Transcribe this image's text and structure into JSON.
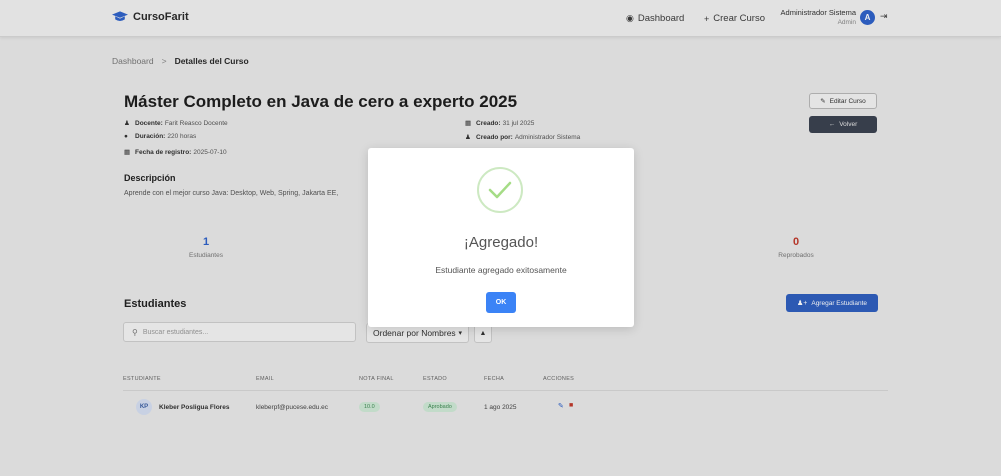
{
  "navbar": {
    "brand": "CursoFarit",
    "dashboard_label": "Dashboard",
    "create_course_label": "Crear Curso",
    "user_name": "Administrador Sistema",
    "user_role": "Admin",
    "avatar_initial": "A"
  },
  "breadcrumb": {
    "home": "Dashboard",
    "separator": ">",
    "current": "Detalles del Curso"
  },
  "course": {
    "title": "Máster Completo en Java de cero a experto 2025",
    "teacher_label": "Docente:",
    "teacher": "Farit Reasco Docente",
    "duration_label": "Duración:",
    "duration": "220 horas",
    "registered_label": "Fecha de registro:",
    "registered": "2025-07-10",
    "created_label": "Creado:",
    "created": "31 jul 2025",
    "created_by_label": "Creado por:",
    "created_by": "Administrador Sistema",
    "edit_button": "Editar Curso",
    "back_button": "Volver",
    "description_title": "Descripción",
    "description": "Aprende con el mejor curso Java: Desktop, Web, Spring, Jakarta EE,"
  },
  "stats": {
    "students_count": "1",
    "students_label": "Estudiantes",
    "failed_count": "0",
    "failed_label": "Reprobados"
  },
  "students": {
    "title": "Estudiantes",
    "add_button": "Agregar Estudiante",
    "search_placeholder": "Buscar estudiantes...",
    "sort_label": "Ordenar por Nombres",
    "sort_dir": "▲",
    "columns": [
      "ESTUDIANTE",
      "EMAIL",
      "NOTA FINAL",
      "ESTADO",
      "FECHA",
      "ACCIONES"
    ],
    "rows": [
      {
        "initials": "KP",
        "name": "Kleber Posligua Flores",
        "email": "kleberpf@pucese.edu.ec",
        "grade": "10.0",
        "status": "Aprobado",
        "date": "1 ago 2025"
      }
    ]
  },
  "modal": {
    "title": "¡Agregado!",
    "message": "Estudiante agregado exitosamente",
    "ok_button": "OK"
  },
  "colors": {
    "primary": "#2f62c9",
    "success": "#3f8a54",
    "danger": "#c0392b",
    "dark_button": "#3b4250"
  }
}
